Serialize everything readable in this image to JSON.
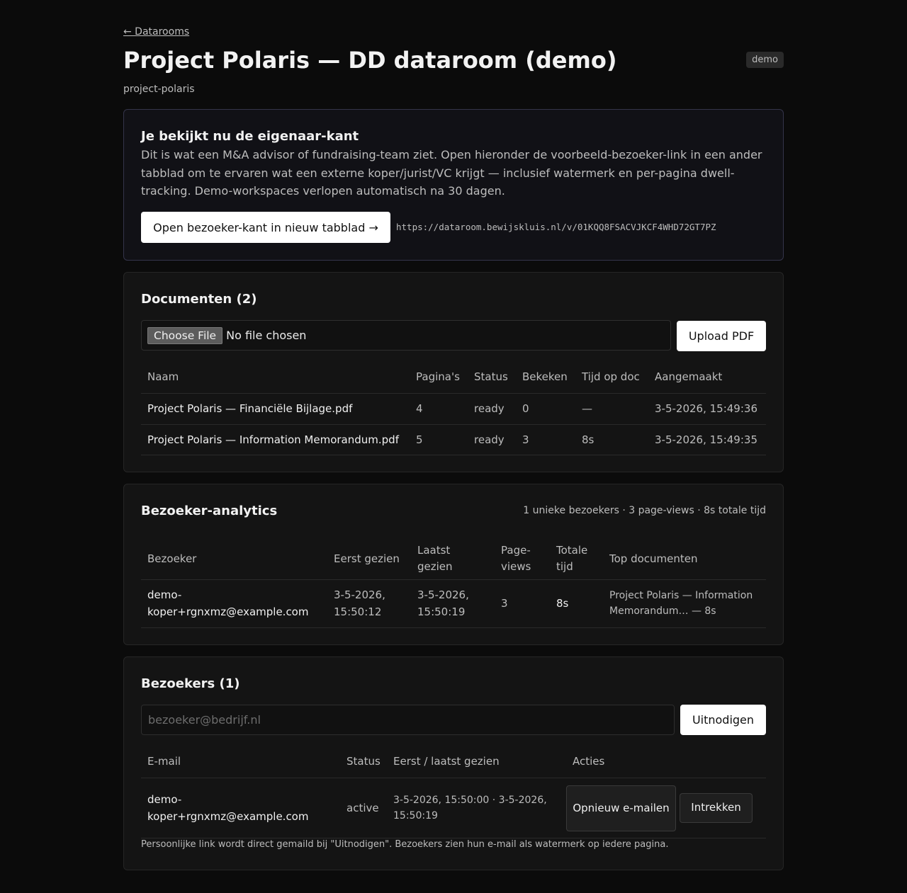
{
  "header": {
    "back_link": "← Datarooms",
    "title": "Project Polaris — DD dataroom (demo)",
    "badge": "demo",
    "slug": "project-polaris"
  },
  "owner_notice": {
    "heading": "Je bekijkt nu de eigenaar-kant",
    "body": "Dit is wat een M&A advisor of fundraising-team ziet. Open hieronder de voorbeeld-bezoeker-link in een ander tabblad om te ervaren wat een externe koper/jurist/VC krijgt — inclusief watermerk en per-pagina dwell-tracking. Demo-workspaces verlopen automatisch na 30 dagen.",
    "open_button": "Open bezoeker-kant in nieuw tabblad →",
    "visitor_url": "https://dataroom.bewijskluis.nl/v/01KQQ8FSACVJKCF4WHD72GT7PZ"
  },
  "documents": {
    "heading": "Documenten (2)",
    "file_button": "Choose File",
    "file_status": "No file chosen",
    "upload_button": "Upload PDF",
    "columns": [
      "Naam",
      "Pagina's",
      "Status",
      "Bekeken",
      "Tijd op doc",
      "Aangemaakt"
    ],
    "rows": [
      [
        "Project Polaris — Financiële Bijlage.pdf",
        "4",
        "ready",
        "0",
        "—",
        "3-5-2026, 15:49:36"
      ],
      [
        "Project Polaris — Information Memorandum.pdf",
        "5",
        "ready",
        "3",
        "8s",
        "3-5-2026, 15:49:35"
      ]
    ]
  },
  "analytics": {
    "heading": "Bezoeker-analytics",
    "summary": "1 unieke bezoekers · 3 page-views · 8s totale tijd",
    "columns": [
      "Bezoeker",
      "Eerst gezien",
      "Laatst gezien",
      "Page-views",
      "Totale tijd",
      "Top documenten"
    ],
    "rows": [
      [
        "demo-koper+rgnxmz@example.com",
        "3-5-2026, 15:50:12",
        "3-5-2026, 15:50:19",
        "3",
        "8s",
        "Project Polaris — Information Memorandum… — 8s"
      ]
    ]
  },
  "visitors": {
    "heading": "Bezoekers (1)",
    "email_placeholder": "bezoeker@bedrijf.nl",
    "invite_button": "Uitnodigen",
    "columns": [
      "E-mail",
      "Status",
      "Eerst / laatst gezien",
      "Acties"
    ],
    "rows": [
      {
        "email": "demo-koper+rgnxmz@example.com",
        "status": "active",
        "seen": "3-5-2026, 15:50:00 · 3-5-2026, 15:50:19",
        "resend_label": "Opnieuw e-mailen",
        "revoke_label": "Intrekken"
      }
    ],
    "note": "Persoonlijke link wordt direct gemaild bij \"Uitnodigen\". Bezoekers zien hun e-mail als watermerk op iedere pagina."
  }
}
